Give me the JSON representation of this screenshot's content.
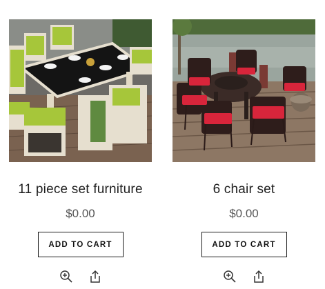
{
  "products": [
    {
      "title": "11 piece set furniture",
      "price": "$0.00",
      "button_label": "ADD TO CART",
      "image_icon": "patio-dining-set-photo",
      "icons": [
        "zoom-in-icon",
        "share-icon"
      ]
    },
    {
      "title": "6 chair set",
      "price": "$0.00",
      "button_label": "ADD TO CART",
      "image_icon": "outdoor-chair-set-photo",
      "icons": [
        "zoom-in-icon",
        "share-icon"
      ]
    }
  ],
  "colors": {
    "text": "#1e1e1e",
    "price": "#555555",
    "button_border": "#1a1a1a",
    "cushion_lime": "#a6c63a",
    "cushion_red": "#d8253b"
  }
}
